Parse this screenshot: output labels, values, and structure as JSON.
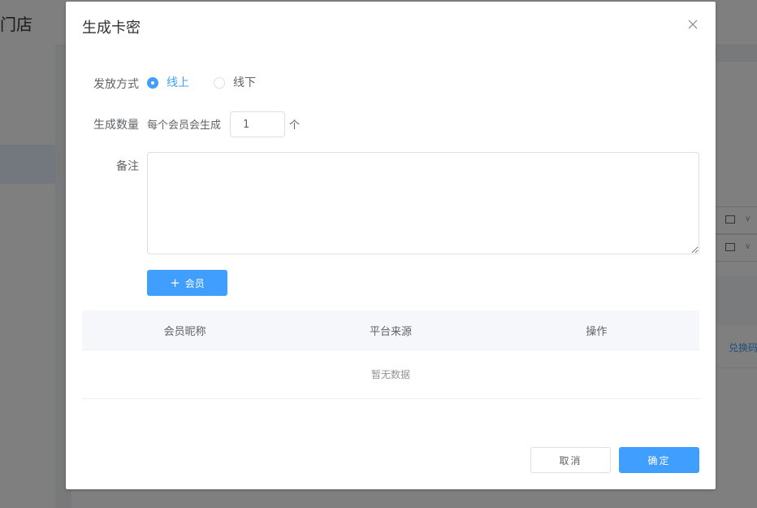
{
  "background": {
    "sidebar_title": "门店",
    "right_link": "兑换码"
  },
  "dialog": {
    "title": "生成卡密",
    "close_icon": "close-icon",
    "issue_method": {
      "label": "发放方式",
      "options": [
        "线上",
        "线下"
      ],
      "selected": "线上"
    },
    "quantity": {
      "label": "生成数量",
      "prefix": "每个会员会生成",
      "value": "1",
      "suffix": "个"
    },
    "note": {
      "label": "备注",
      "value": ""
    },
    "add_member_button": "会员",
    "table": {
      "columns": [
        "会员昵称",
        "平台来源",
        "操作"
      ],
      "empty_text": "暂无数据"
    },
    "cancel_button": "取消",
    "confirm_button": "确定"
  },
  "colors": {
    "primary": "#409eff",
    "overlay": "rgba(0,0,0,0.5)"
  }
}
